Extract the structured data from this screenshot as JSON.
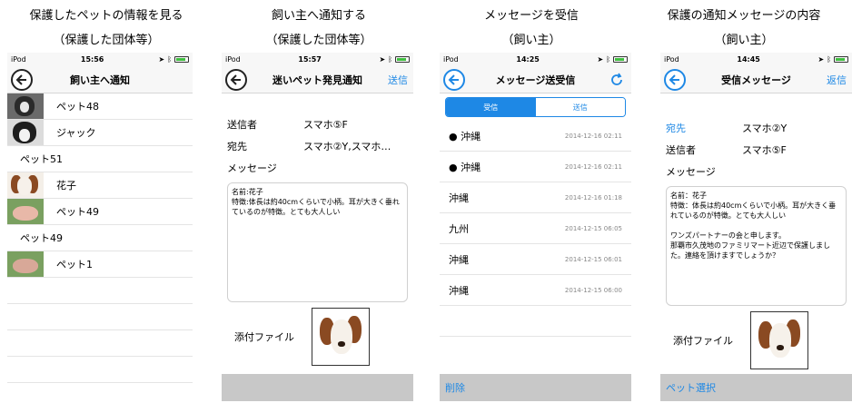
{
  "captions": [
    {
      "line1": "保護したペットの情報を見る",
      "line2": "（保護した団体等）"
    },
    {
      "line1": "飼い主へ通知する",
      "line2": "（保護した団体等）"
    },
    {
      "line1": "メッセージを受信",
      "line2": "（飼い主）"
    },
    {
      "line1": "保護の通知メッセージの内容",
      "line2": "（飼い主）"
    }
  ],
  "phone1": {
    "status": {
      "carrier": "iPod",
      "time": "15:56"
    },
    "title": "飼い主へ通知",
    "rows": [
      {
        "label": "ペット48"
      },
      {
        "label": "ジャック"
      },
      {
        "label": "ペット51"
      },
      {
        "label": "花子"
      },
      {
        "label": "ペット49"
      },
      {
        "label": "ペット49"
      },
      {
        "label": "ペット1"
      }
    ]
  },
  "phone2": {
    "status": {
      "carrier": "iPod",
      "time": "15:57"
    },
    "title": "迷いペット発見通知",
    "action": "送信",
    "sender_label": "送信者",
    "sender": "スマホ⑤F",
    "to_label": "宛先",
    "to": "スマホ②Y,スマホ…",
    "message_label": "メッセージ",
    "message": "名前:花子\n特徴:体長は約40cmくらいで小柄。耳が大きく垂れているのが特徴。とても大人しい",
    "attach_label": "添付ファイル"
  },
  "phone3": {
    "status": {
      "carrier": "iPod",
      "time": "14:25"
    },
    "title": "メッセージ送受信",
    "seg_receive": "受信",
    "seg_send": "送信",
    "messages": [
      {
        "unread": "●",
        "place": "沖縄",
        "date": "2014-12-16 02:11"
      },
      {
        "unread": "●",
        "place": "沖縄",
        "date": "2014-12-16 02:11"
      },
      {
        "unread": "",
        "place": "沖縄",
        "date": "2014-12-16 01:18"
      },
      {
        "unread": "",
        "place": "九州",
        "date": "2014-12-15 06:05"
      },
      {
        "unread": "",
        "place": "沖縄",
        "date": "2014-12-15 06:01"
      },
      {
        "unread": "",
        "place": "沖縄",
        "date": "2014-12-15 06:00"
      }
    ],
    "delete": "削除"
  },
  "phone4": {
    "status": {
      "carrier": "iPod",
      "time": "14:45"
    },
    "title": "受信メッセージ",
    "action": "返信",
    "to_label": "宛先",
    "to": "スマホ②Y",
    "sender_label": "送信者",
    "sender": "スマホ⑤F",
    "message_label": "メッセージ",
    "message": "名前：花子\n特徴：体長は約40cmくらいで小柄。耳が大きく垂れているのが特徴。とても大人しい\n\nワンズパートナーの会と申します。\n那覇市久茂地のファミリマート近辺で保護しました。連絡を頂けますでしょうか？",
    "attach_label": "添付ファイル",
    "pet_select": "ペット選択"
  }
}
